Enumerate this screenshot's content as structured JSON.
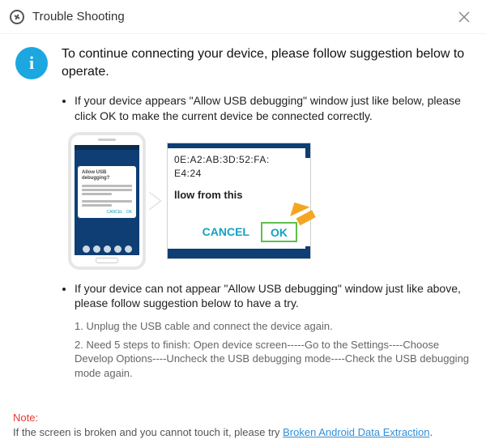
{
  "window": {
    "title": "Trouble Shooting"
  },
  "intro": "To continue connecting your device, please follow suggestion below to operate.",
  "bullet1": "If your device appears \"Allow USB debugging\" window just like below, please click OK to make the current device  be connected correctly.",
  "zoomed": {
    "fingerprint_line1": "0E:A2:AB:3D:52:FA:",
    "fingerprint_line2": "E4:24",
    "allow_text": "llow from this",
    "cancel": "CANCEL",
    "ok": "OK"
  },
  "phone_dialog_title": "Allow USB debugging?",
  "bullet2": "If your device can not appear \"Allow USB debugging\" window just like above, please follow suggestion below to have a try.",
  "steps": {
    "s1": "1. Unplug the USB cable and connect the device again.",
    "s2": "2. Need 5 steps to finish: Open device screen-----Go to the Settings----Choose Develop Options----Uncheck the USB debugging mode----Check the USB debugging mode again."
  },
  "note": {
    "label": "Note:",
    "text": "If the screen is broken and you cannot touch it, please try ",
    "link": "Broken Android Data Extraction",
    "suffix": "."
  }
}
